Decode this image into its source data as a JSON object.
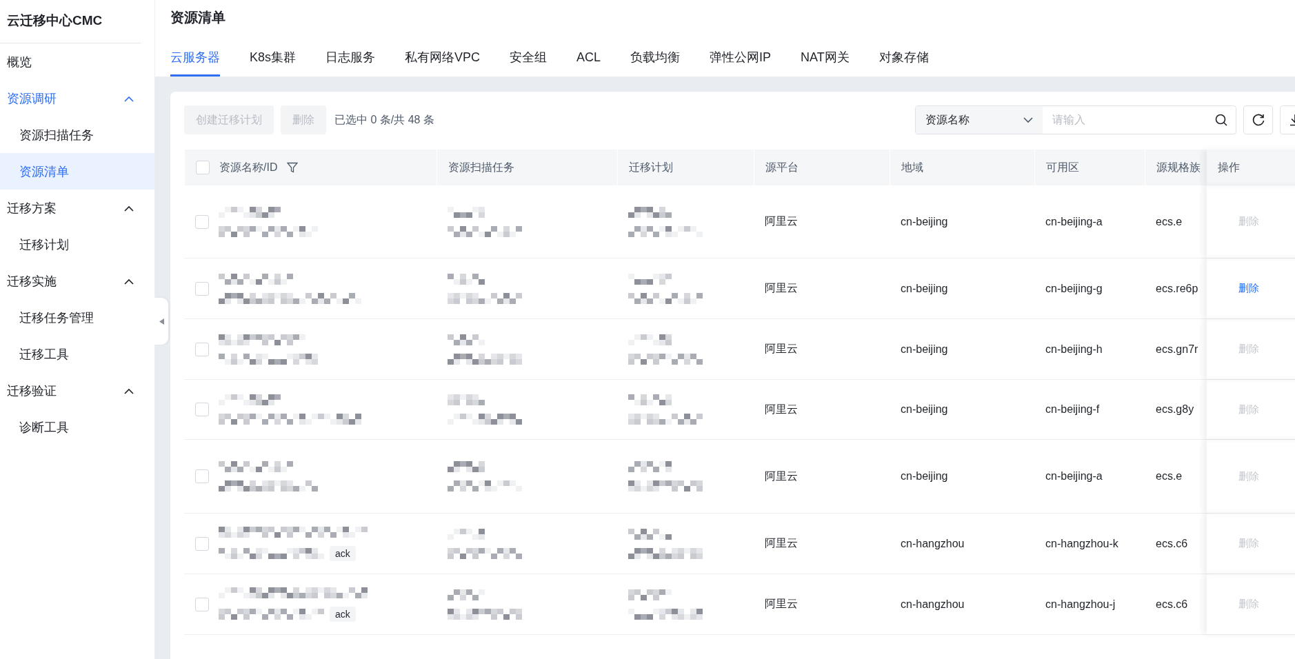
{
  "sidebar": {
    "title": "云迁移中心CMC",
    "items": [
      {
        "label": "概览",
        "selected": false
      },
      {
        "label": "资源调研",
        "expanded": true,
        "selected": false,
        "children": [
          {
            "label": "资源扫描任务",
            "selected": false
          },
          {
            "label": "资源清单",
            "selected": true
          }
        ]
      },
      {
        "label": "迁移方案",
        "expanded": true,
        "selected": false,
        "children": [
          {
            "label": "迁移计划",
            "selected": false
          }
        ]
      },
      {
        "label": "迁移实施",
        "expanded": true,
        "selected": false,
        "children": [
          {
            "label": "迁移任务管理",
            "selected": false
          },
          {
            "label": "迁移工具",
            "selected": false
          }
        ]
      },
      {
        "label": "迁移验证",
        "expanded": true,
        "selected": false,
        "children": [
          {
            "label": "诊断工具",
            "selected": false
          }
        ]
      }
    ]
  },
  "page_title": "资源清单",
  "tabs": [
    {
      "label": "云服务器",
      "selected": true
    },
    {
      "label": "K8s集群",
      "selected": false
    },
    {
      "label": "日志服务",
      "selected": false
    },
    {
      "label": "私有网络VPC",
      "selected": false
    },
    {
      "label": "安全组",
      "selected": false
    },
    {
      "label": "ACL",
      "selected": false
    },
    {
      "label": "负载均衡",
      "selected": false
    },
    {
      "label": "弹性公网IP",
      "selected": false
    },
    {
      "label": "NAT网关",
      "selected": false
    },
    {
      "label": "对象存储",
      "selected": false
    }
  ],
  "toolbar": {
    "buttons": [
      {
        "label": "创建迁移计划",
        "disabled": true
      },
      {
        "label": "删除",
        "disabled": true
      }
    ],
    "selection_count": "已选中 0 条/共 48 条",
    "search_field_select": "资源名称",
    "search": {
      "placeholder": "请输入"
    }
  },
  "table": {
    "columns": [
      "资源名称/ID",
      "资源扫描任务",
      "迁移计划",
      "源平台",
      "地域",
      "可用区",
      "源规格族",
      "操作"
    ],
    "header_checked": false,
    "rows": [
      {
        "checked": false,
        "platform": "阿里云",
        "region": "cn-beijing",
        "zone": "cn-beijing-a",
        "family": "ecs.e",
        "action": {
          "label": "删除",
          "disabled": true
        }
      },
      {
        "checked": false,
        "platform": "阿里云",
        "region": "cn-beijing",
        "zone": "cn-beijing-g",
        "family": "ecs.re6p",
        "action": {
          "label": "删除",
          "disabled": false
        }
      },
      {
        "checked": false,
        "platform": "阿里云",
        "region": "cn-beijing",
        "zone": "cn-beijing-h",
        "family": "ecs.gn7r",
        "action": {
          "label": "删除",
          "disabled": true
        }
      },
      {
        "checked": false,
        "platform": "阿里云",
        "region": "cn-beijing",
        "zone": "cn-beijing-f",
        "family": "ecs.g8y",
        "action": {
          "label": "删除",
          "disabled": true
        }
      },
      {
        "checked": false,
        "platform": "阿里云",
        "region": "cn-beijing",
        "zone": "cn-beijing-a",
        "family": "ecs.e",
        "action": {
          "label": "删除",
          "disabled": true
        }
      },
      {
        "checked": false,
        "tag": "ack",
        "platform": "阿里云",
        "region": "cn-hangzhou",
        "zone": "cn-hangzhou-k",
        "family": "ecs.c6",
        "action": {
          "label": "删除",
          "disabled": true
        }
      },
      {
        "checked": false,
        "tag": "ack",
        "platform": "阿里云",
        "region": "cn-hangzhou",
        "zone": "cn-hangzhou-j",
        "family": "ecs.c6",
        "action": {
          "label": "删除",
          "disabled": true
        }
      }
    ]
  }
}
